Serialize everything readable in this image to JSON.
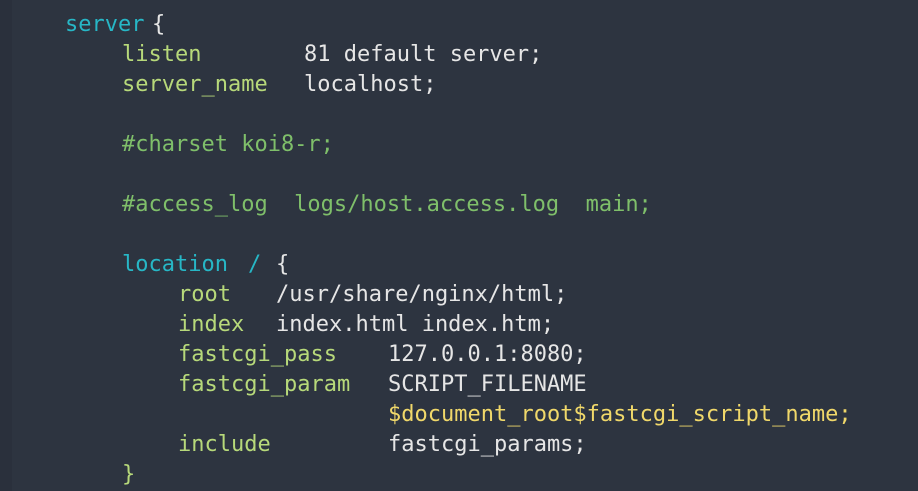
{
  "code": {
    "server_kw": "server",
    "brace_open": "{",
    "listen_kw": "listen",
    "listen_val": "81 default server;",
    "server_name_kw": "server_name",
    "server_name_val": "localhost;",
    "comment_charset": "#charset koi8-r;",
    "comment_access_log": "#access_log  logs/host.access.log  main;",
    "location_kw": "location",
    "location_path": "/",
    "location_brace": "{",
    "root_kw": "root",
    "root_val": "/usr/share/nginx/html;",
    "index_kw": "index",
    "index_val": "index.html index.htm;",
    "fastcgi_pass_kw": "fastcgi_pass",
    "fastcgi_pass_val": "127.0.0.1:8080;",
    "fastcgi_param_kw": "fastcgi_param",
    "fastcgi_param_val1": "SCRIPT_FILENAME",
    "fastcgi_param_val2": "$document_root$fastcgi_script_name;",
    "include_kw": "include",
    "include_val": "fastcgi_params;",
    "brace_close": "}"
  },
  "colors": {
    "background": "#2d3440",
    "block_keyword": "#27b7c6",
    "directive": "#b7d97a",
    "comment": "#7fbf6a",
    "value": "#e6e6e6",
    "variable": "#f0d86a"
  }
}
